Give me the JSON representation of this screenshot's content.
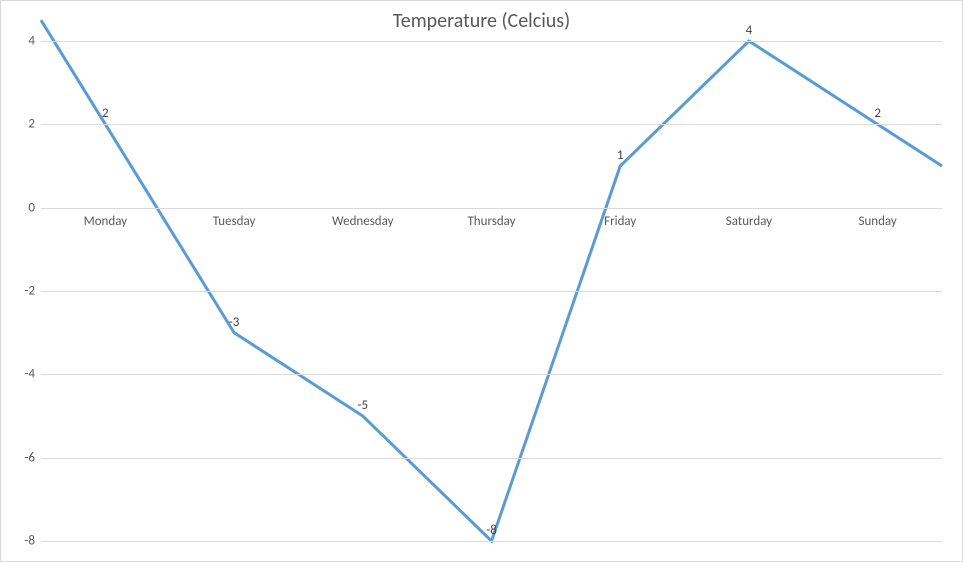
{
  "chart_data": {
    "type": "line",
    "title": "Temperature (Celcius)",
    "categories": [
      "Monday",
      "Tuesday",
      "Wednesday",
      "Thursday",
      "Friday",
      "Saturday",
      "Sunday"
    ],
    "values": [
      2,
      -3,
      -5,
      -8,
      1,
      4,
      2
    ],
    "ylim": [
      -8,
      4
    ],
    "y_ticks": [
      4,
      2,
      0,
      -2,
      -4,
      -6,
      -8
    ],
    "xlabel": "",
    "ylabel": "",
    "line_color": "#5b9bd5"
  }
}
